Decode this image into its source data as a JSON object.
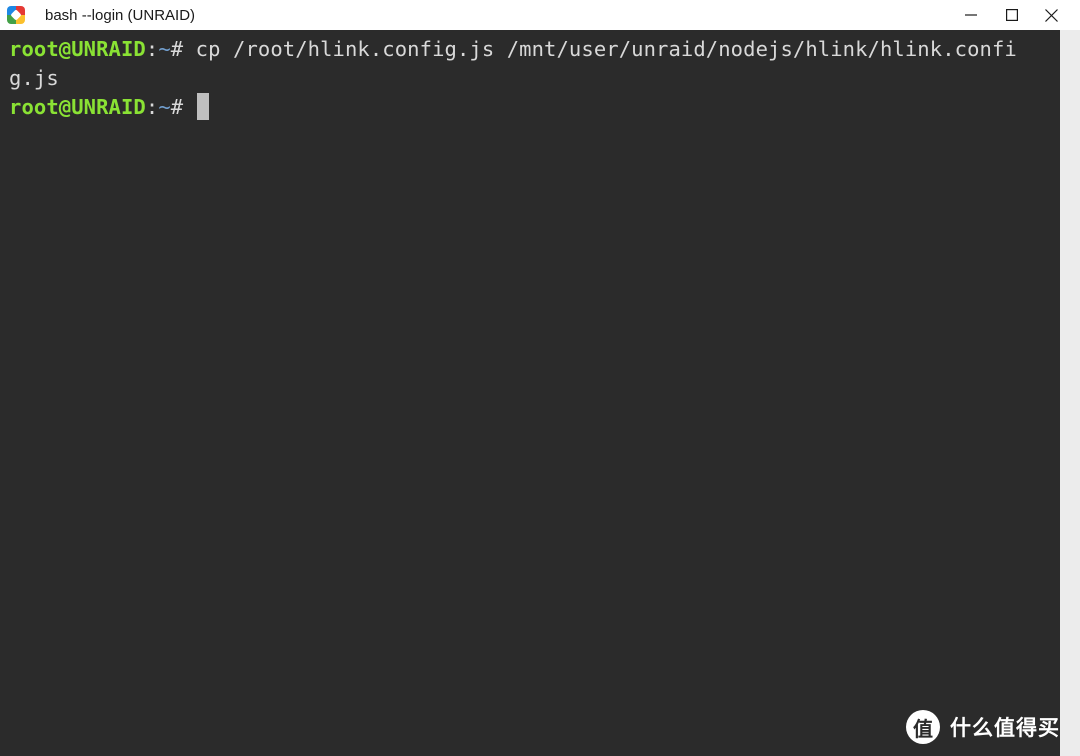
{
  "window": {
    "title": "bash --login (UNRAID)",
    "icon": "mintty-icon"
  },
  "terminal": {
    "lines": [
      {
        "prompt_user": "root@UNRAID",
        "prompt_sep": ":",
        "prompt_path": "~",
        "prompt_end": "# ",
        "command": "cp /root/hlink.config.js /mnt/user/unraid/nodejs/hlink/hlink.confi"
      },
      {
        "text": "g.js"
      },
      {
        "prompt_user": "root@UNRAID",
        "prompt_sep": ":",
        "prompt_path": "~",
        "prompt_end": "# ",
        "command": ""
      }
    ]
  },
  "watermark": {
    "logo_text": "值",
    "text": "什么值得买"
  },
  "colors": {
    "background": "#2b2b2b",
    "prompt_user": "#8ae234",
    "prompt_path": "#729fcf",
    "text": "#d9d9d9"
  }
}
